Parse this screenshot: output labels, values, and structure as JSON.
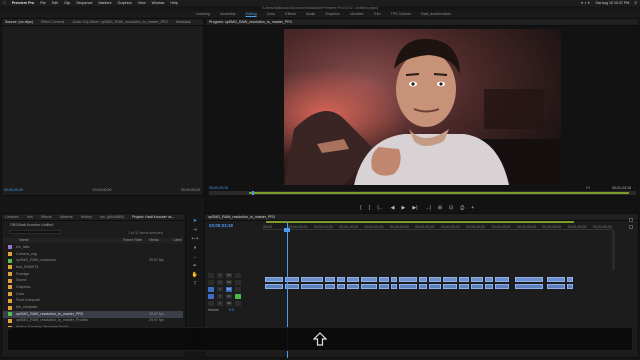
{
  "menubar": {
    "app": "Premiere Pro",
    "items": [
      "File",
      "Edit",
      "Clip",
      "Sequence",
      "Markers",
      "Graphics",
      "View",
      "Window",
      "Help"
    ],
    "clock": "Sat Aug 10  10:37 PM"
  },
  "window_title": "/Users/hadiknown/Documents/Adobe/Premiere Pro/14.0/...Untitled.prproj",
  "workspaces": {
    "items": [
      "Learning",
      "Assembly",
      "Editing",
      "Color",
      "Effects",
      "Audio",
      "Graphics",
      "Libraries",
      "Trim",
      "TPS Custom",
      "Hadi_doubleclickin"
    ],
    "active_index": 2
  },
  "source_panel": {
    "tabs": [
      "Source: (no clips)",
      "Effect Controls",
      "Audio Clip Mixer: upSMG_RAW_resolution_to_master_PR3",
      "Metadata"
    ],
    "active_index": 0,
    "tc_left": "00;00;00;00",
    "tc_center": "00;00;00;00",
    "tc_right": "00;00;00;00"
  },
  "program_panel": {
    "title": "Program: upSMG_RAW_resolution_to_master_PR3",
    "timecode": "00;00;03;18",
    "fit": "Fit",
    "duration": "00;01;13;18",
    "playhead_fraction": 0.1
  },
  "transport": [
    "{",
    "}",
    "|←",
    "◀",
    "▶",
    "▶|",
    "→|",
    "⊞",
    "⊡",
    "⎙",
    "+"
  ],
  "project_panel": {
    "tabs": [
      "Libraries",
      "Info",
      "Effects",
      "Markers",
      "History",
      "Ins: (p6/o0883)",
      "Project: Hadi Knocker vs..."
    ],
    "active_index": 6,
    "title": "OBS/Hadi Knocker Untitled",
    "items_selected": "1 of 11 items selected",
    "columns": {
      "name": "Name",
      "frame_rate": "Frame Rate",
      "media_start": "Media",
      "label": "Label"
    },
    "rows": [
      {
        "name": "bin_fake",
        "color": "#9b73c8",
        "rate": ""
      },
      {
        "name": "Camera_orig",
        "color": "#e2a23b",
        "rate": ""
      },
      {
        "name": "upSMG_RAW_resolution",
        "color": "#4ec24a",
        "rate": "29.97 fps"
      },
      {
        "name": "bob_RAW973",
        "color": "#e2a23b",
        "rate": ""
      },
      {
        "name": "Footage",
        "color": "#e2a23b",
        "rate": ""
      },
      {
        "name": "Sound",
        "color": "#e2a23b",
        "rate": ""
      },
      {
        "name": "Graphics",
        "color": "#e2a23b",
        "rate": ""
      },
      {
        "name": "Color",
        "color": "#e2a23b",
        "rate": ""
      },
      {
        "name": "Final Compose",
        "color": "#e2a23b",
        "rate": ""
      },
      {
        "name": "bin_compose",
        "color": "#e2a23b",
        "rate": ""
      },
      {
        "name": "upSMG_RAW_resolution_to_master_PR3",
        "color": "#4ec24a",
        "rate": "29.97 fps",
        "selected": true
      },
      {
        "name": "upSMG_RAW_resolution_to_master_Proxies",
        "color": "#e2a23b",
        "rate": "29.97 fps"
      },
      {
        "name": "Motion Graphics Template Media",
        "color": "#e2a23b",
        "rate": ""
      }
    ]
  },
  "timeline": {
    "tab": "upSMG_RAW_resolution_to_master_PR3",
    "timecode": "00;00;03;18",
    "ruler": [
      "00;00",
      "00;00;05;00",
      "00;00;10;00",
      "00;00;15;00",
      "00;00;20;00",
      "00;00;25;00",
      "00;00;30;00",
      "00;00;35;00",
      "00;00;40;00",
      "00;00;45;00",
      "00;00;50;00",
      "00;00;55;00",
      "00;01;00;00",
      "00;01;05;00"
    ],
    "tracks": [
      {
        "name": "V3",
        "label": "V3"
      },
      {
        "name": "V2",
        "label": "V2"
      },
      {
        "name": "V1",
        "label": "V1"
      },
      {
        "name": "A1",
        "label": "A1"
      },
      {
        "name": "A2",
        "label": "A2"
      }
    ],
    "master_label": "Master",
    "master_value": "0.0"
  },
  "icons": {
    "overlay": "share-arrow-up-icon"
  }
}
